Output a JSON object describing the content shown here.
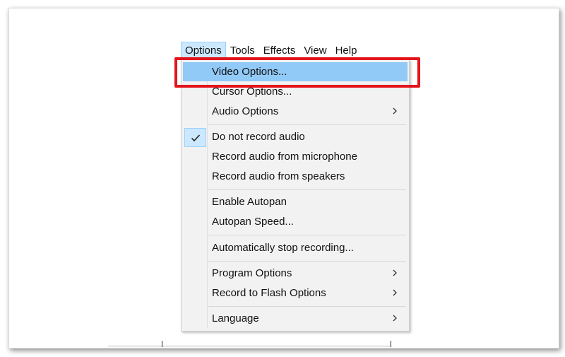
{
  "menubar": {
    "items": [
      {
        "label": "Options",
        "open": true
      },
      {
        "label": "Tools"
      },
      {
        "label": "Effects"
      },
      {
        "label": "View"
      },
      {
        "label": "Help"
      }
    ]
  },
  "dropdown": {
    "items": [
      {
        "label": "Video Options...",
        "highlighted": true
      },
      {
        "label": "Cursor Options..."
      },
      {
        "label": "Audio Options",
        "submenu": true
      },
      {
        "label": "Do not record audio",
        "checked": true
      },
      {
        "label": "Record audio from microphone"
      },
      {
        "label": "Record audio from speakers"
      },
      {
        "label": "Enable Autopan"
      },
      {
        "label": "Autopan Speed..."
      },
      {
        "label": "Automatically stop recording..."
      },
      {
        "label": "Program Options",
        "submenu": true
      },
      {
        "label": "Record to Flash Options",
        "submenu": true
      },
      {
        "label": "Language",
        "submenu": true
      }
    ]
  },
  "colors": {
    "highlight": "#91c9f7",
    "annotation_red": "#e3141b",
    "check_bg": "#cce8ff"
  },
  "icons": {
    "check": "check-icon",
    "submenu": "chevron-right-icon"
  }
}
